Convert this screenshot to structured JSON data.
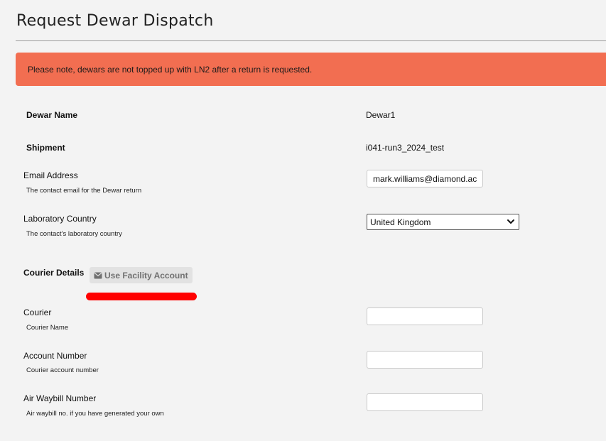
{
  "header": {
    "title": "Request Dewar Dispatch"
  },
  "notice": {
    "text": "Please note, dewars are not topped up with LN2 after a return is requested."
  },
  "dewar": {
    "name_label": "Dewar Name",
    "name_value": "Dewar1",
    "shipment_label": "Shipment",
    "shipment_value": "i041-run3_2024_test"
  },
  "email": {
    "label": "Email Address",
    "help": "The contact email for the Dewar return",
    "value": "mark.williams@diamond.ac"
  },
  "country": {
    "label": "Laboratory Country",
    "help": "The contact's laboratory country",
    "selected": "United Kingdom",
    "icon": "chevron-down-icon"
  },
  "courier_details": {
    "label": "Courier Details",
    "facility_button_label": "Use Facility Account",
    "facility_button_icon": "envelope-icon",
    "highlight_color": "#ff0000"
  },
  "courier": {
    "label": "Courier",
    "help": "Courier Name",
    "value": ""
  },
  "account": {
    "label": "Account Number",
    "help": "Courier account number",
    "value": ""
  },
  "waybill": {
    "label": "Air Waybill Number",
    "help": "Air waybill no. if you have generated your own",
    "value": ""
  },
  "colors": {
    "notice_bg": "#f26e51",
    "page_bg": "#f3f3f3"
  }
}
